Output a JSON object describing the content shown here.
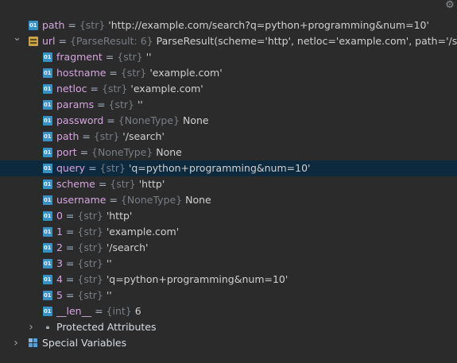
{
  "rows": [
    {
      "indent": 0,
      "arrow": "",
      "icon": "prim",
      "name": "path",
      "type": "{str}",
      "value": "'http://example.com/search?q=python+programming&num=10'"
    },
    {
      "indent": 0,
      "arrow": "v",
      "icon": "obj",
      "name": "url",
      "type": "{ParseResult: 6}",
      "value": "ParseResult(scheme='http', netloc='example.com', path='/search', pa"
    },
    {
      "indent": 1,
      "arrow": "",
      "icon": "prim",
      "name": "fragment",
      "type": "{str}",
      "value": "''"
    },
    {
      "indent": 1,
      "arrow": "",
      "icon": "prim",
      "name": "hostname",
      "type": "{str}",
      "value": "'example.com'"
    },
    {
      "indent": 1,
      "arrow": "",
      "icon": "prim",
      "name": "netloc",
      "type": "{str}",
      "value": "'example.com'"
    },
    {
      "indent": 1,
      "arrow": "",
      "icon": "prim",
      "name": "params",
      "type": "{str}",
      "value": "''"
    },
    {
      "indent": 1,
      "arrow": "",
      "icon": "prim",
      "name": "password",
      "type": "{NoneType}",
      "value": "None"
    },
    {
      "indent": 1,
      "arrow": "",
      "icon": "prim",
      "name": "path",
      "type": "{str}",
      "value": "'/search'"
    },
    {
      "indent": 1,
      "arrow": "",
      "icon": "prim",
      "name": "port",
      "type": "{NoneType}",
      "value": "None"
    },
    {
      "indent": 1,
      "arrow": "",
      "icon": "prim",
      "name": "query",
      "type": "{str}",
      "value": "'q=python+programming&num=10'",
      "selected": true
    },
    {
      "indent": 1,
      "arrow": "",
      "icon": "prim",
      "name": "scheme",
      "type": "{str}",
      "value": "'http'"
    },
    {
      "indent": 1,
      "arrow": "",
      "icon": "prim",
      "name": "username",
      "type": "{NoneType}",
      "value": "None"
    },
    {
      "indent": 1,
      "arrow": "",
      "icon": "prim",
      "name": "0",
      "type": "{str}",
      "value": "'http'"
    },
    {
      "indent": 1,
      "arrow": "",
      "icon": "prim",
      "name": "1",
      "type": "{str}",
      "value": "'example.com'"
    },
    {
      "indent": 1,
      "arrow": "",
      "icon": "prim",
      "name": "2",
      "type": "{str}",
      "value": "'/search'"
    },
    {
      "indent": 1,
      "arrow": "",
      "icon": "prim",
      "name": "3",
      "type": "{str}",
      "value": "''"
    },
    {
      "indent": 1,
      "arrow": "",
      "icon": "prim",
      "name": "4",
      "type": "{str}",
      "value": "'q=python+programming&num=10'"
    },
    {
      "indent": 1,
      "arrow": "",
      "icon": "prim",
      "name": "5",
      "type": "{str}",
      "value": "''"
    },
    {
      "indent": 1,
      "arrow": "",
      "icon": "prim",
      "name": "__len__",
      "type": "{int}",
      "value": "6"
    },
    {
      "indent": 1,
      "arrow": ">",
      "icon": "lock",
      "name": "Protected Attributes",
      "type": "",
      "value": "",
      "plain": true
    },
    {
      "indent": 0,
      "arrow": ">",
      "icon": "vars",
      "name": "Special Variables",
      "type": "",
      "value": "",
      "plain": true,
      "root": true
    }
  ],
  "icons": {
    "settings": "gear-icon",
    "primitive": "primitive-value-icon",
    "object": "object-value-icon",
    "protected": "lock-icon",
    "special": "special-variables-icon"
  }
}
